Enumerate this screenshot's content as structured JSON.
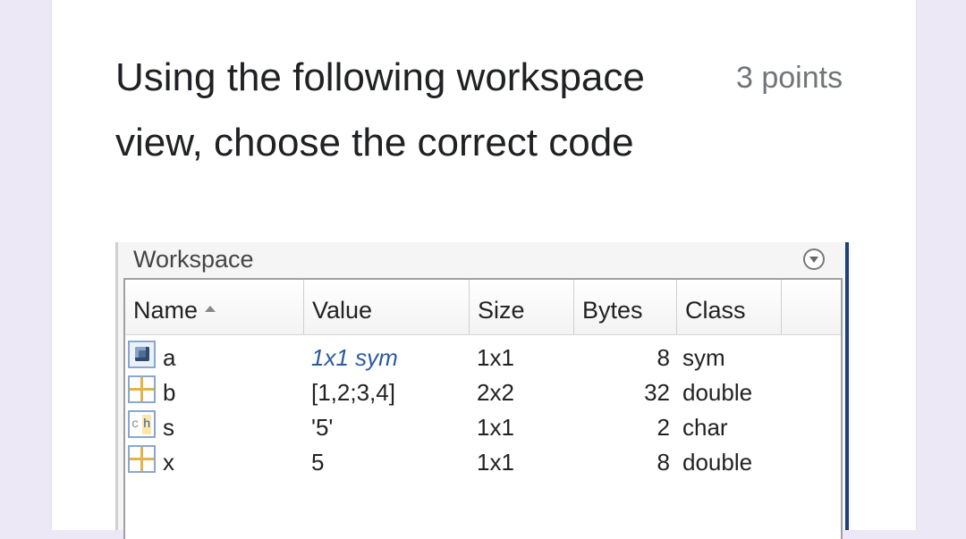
{
  "question": {
    "text": "Using the following workspace view, choose the correct code",
    "points": "3 points"
  },
  "workspace": {
    "title": "Workspace",
    "menu_icon": "circle-chevron-down-icon",
    "columns": [
      "Name",
      "Value",
      "Size",
      "Bytes",
      "Class"
    ],
    "sort_column": "Name",
    "rows": [
      {
        "icon": "sym-cube-icon",
        "name": "a",
        "value": "1x1 sym",
        "size": "1x1",
        "bytes": "8",
        "class": "sym"
      },
      {
        "icon": "matrix-grid-icon",
        "name": "b",
        "value": "[1,2;3,4]",
        "size": "2x2",
        "bytes": "32",
        "class": "double"
      },
      {
        "icon": "char-array-icon",
        "name": "s",
        "value": "'5'",
        "size": "1x1",
        "bytes": "2",
        "class": "char"
      },
      {
        "icon": "matrix-grid-icon",
        "name": "x",
        "value": "5",
        "size": "1x1",
        "bytes": "8",
        "class": "double"
      }
    ]
  },
  "colors": {
    "page_bg": "#ece8f6",
    "card_bg": "#ffffff",
    "sym_value": "#2a5aa0",
    "panel_accent": "#1f3f77"
  }
}
